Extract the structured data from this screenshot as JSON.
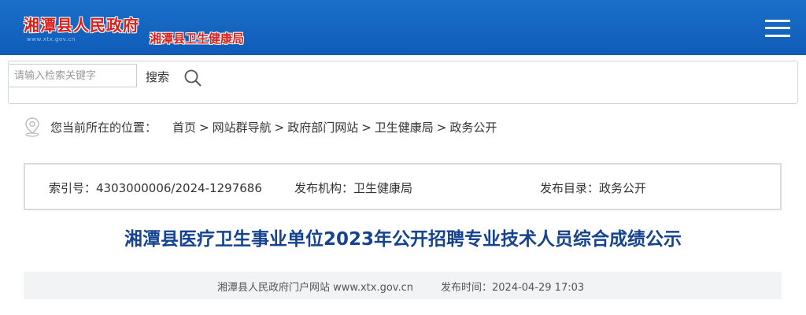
{
  "header": {
    "site_title": "湘潭县人民政府",
    "site_domain": "www.xtx.gov.cn",
    "dept_title": "湘潭县卫生健康局",
    "menu_icon": "hamburger-menu-icon",
    "colors": {
      "bar": "#1566c2",
      "logo_red": "#d9201a"
    }
  },
  "search": {
    "placeholder": "请输入检索关键字",
    "value": "",
    "button_label": "搜索",
    "icon": "search-icon"
  },
  "breadcrumb": {
    "icon": "location-pin-icon",
    "prefix": "您当前所在的位置：",
    "items": [
      "首页",
      "网站群导航",
      "政府部门网站",
      "卫生健康局",
      "政务公开"
    ],
    "separator": ">"
  },
  "meta": {
    "index_no": "索引号：4303000006/2024-1297686",
    "publisher": "发布机构：卫生健康局",
    "catalog": "发布目录：政务公开"
  },
  "article": {
    "title": "湘潭县医疗卫生事业单位2023年公开招聘专业技术人员综合成绩公示",
    "source": "湘潭县人民政府门户网站 www.xtx.gov.cn",
    "publish_time": "发布时间：2024-04-29 17:03",
    "title_color": "#15438f"
  }
}
